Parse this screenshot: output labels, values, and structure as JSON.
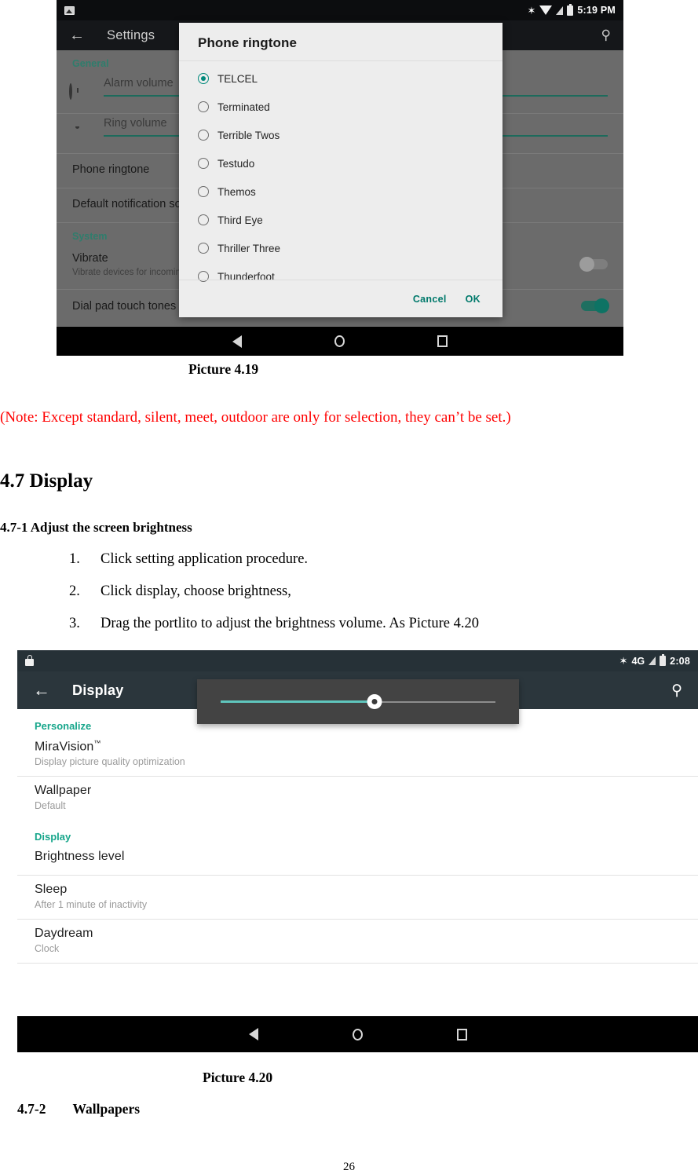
{
  "document": {
    "page_number": "26",
    "caption_419": "Picture 4.19",
    "caption_420": "Picture 4.20",
    "note": "(Note: Except standard, silent, meet, outdoor are only for selection, they can’t be set.)",
    "note_color": "#ff0000",
    "heading_display": "4.7 Display",
    "heading_brightness": "4.7-1 Adjust the screen brightness",
    "heading_wallpapers_num": "4.7-2",
    "heading_wallpapers_text": "Wallpapers",
    "steps": [
      {
        "num": "1.",
        "text": "Click setting application procedure."
      },
      {
        "num": "2.",
        "text": "Click display, choose brightness,"
      },
      {
        "num": "3.",
        "text": "Drag the portlito to adjust the brightness volume. As Picture 4.20"
      }
    ]
  },
  "figure_419": {
    "statusbar": {
      "left_icon": "picture-icon",
      "icons": [
        "bluetooth-icon",
        "wifi-icon",
        "signal-icon",
        "battery-icon"
      ],
      "time": "5:19 PM"
    },
    "appbar": {
      "back_icon": "arrow-back-icon",
      "title": "Settings",
      "search_icon": "search-icon"
    },
    "sections": [
      {
        "header": "General"
      },
      {
        "header": "System"
      }
    ],
    "rows": [
      {
        "icon": "alarm-clock-icon",
        "label": "Alarm volume",
        "type": "slider"
      },
      {
        "icon": "bell-icon",
        "label": "Ring volume",
        "type": "slider"
      },
      {
        "label": "Phone ringtone",
        "type": "item"
      },
      {
        "label": "Default notification sou",
        "type": "item"
      },
      {
        "label": "Vibrate",
        "sub": "Vibrate devices for incomin",
        "type": "toggle",
        "state": "off"
      },
      {
        "label": "Dial pad touch tones",
        "type": "toggle",
        "state": "on"
      }
    ],
    "dialog": {
      "title": "Phone ringtone",
      "options": [
        {
          "label": "TELCEL",
          "selected": true
        },
        {
          "label": "Terminated",
          "selected": false
        },
        {
          "label": "Terrible Twos",
          "selected": false
        },
        {
          "label": "Testudo",
          "selected": false
        },
        {
          "label": "Themos",
          "selected": false
        },
        {
          "label": "Third Eye",
          "selected": false
        },
        {
          "label": "Thriller Three",
          "selected": false
        },
        {
          "label": "Thunderfoot",
          "selected": false
        }
      ],
      "cancel_label": "Cancel",
      "ok_label": "OK",
      "accent_color": "#00796b"
    },
    "navbar": [
      "back-nav-icon",
      "home-nav-icon",
      "recents-nav-icon"
    ]
  },
  "figure_420": {
    "statusbar": {
      "left_icon": "lock-icon",
      "icons": [
        "bluetooth-icon",
        "signal-icon",
        "battery-icon"
      ],
      "network": "4G",
      "time": "2:08"
    },
    "appbar": {
      "back_icon": "arrow-back-icon",
      "title": "Display",
      "search_icon": "search-icon"
    },
    "brightness_popup": {
      "slider_value_percent": 56,
      "thumb_icon": "brightness-sun-icon",
      "fill_color": "#5fc6bd"
    },
    "groups": [
      {
        "header": "Personalize",
        "items": [
          {
            "title": "MiraVision",
            "trademark": "™",
            "sub": "Display picture quality optimization"
          },
          {
            "title": "Wallpaper",
            "sub": "Default"
          }
        ]
      },
      {
        "header": "Display",
        "items": [
          {
            "title": "Brightness level",
            "sub": ""
          },
          {
            "title": "Sleep",
            "sub": "After 1 minute of inactivity"
          },
          {
            "title": "Daydream",
            "sub": "Clock"
          }
        ]
      }
    ],
    "navbar": [
      "back-nav-icon",
      "home-nav-icon",
      "recents-nav-icon"
    ]
  }
}
